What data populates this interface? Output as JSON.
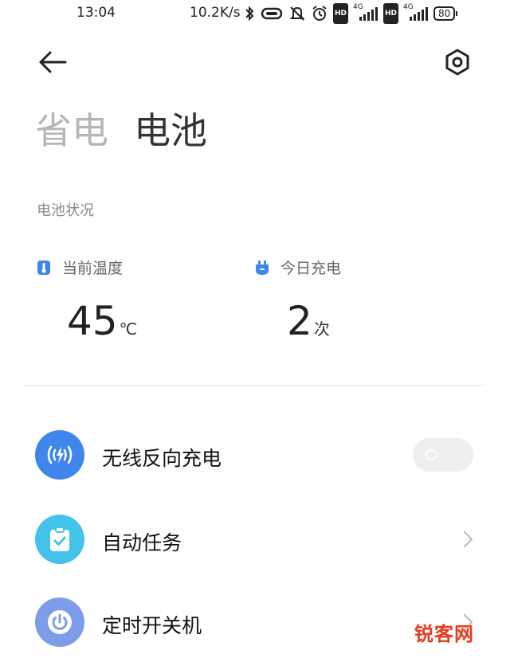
{
  "status_bar": {
    "time": "13:04",
    "net_speed": "10.2K/s",
    "signal_1_label": "4G",
    "signal_2_label": "4G",
    "hd_label": "HD",
    "battery_level": "80"
  },
  "header": {
    "tab_power_save": "省电",
    "tab_battery": "电池"
  },
  "battery_status": {
    "section_label": "电池状况",
    "temperature": {
      "label": "当前温度",
      "value": "45",
      "unit": "℃"
    },
    "charges_today": {
      "label": "今日充电",
      "value": "2",
      "unit": "次"
    }
  },
  "settings": {
    "wireless_reverse_charging": {
      "label": "无线反向充电",
      "enabled": false
    },
    "auto_tasks": {
      "label": "自动任务"
    },
    "scheduled_power": {
      "label": "定时开关机"
    }
  },
  "watermark": "锐客网",
  "colors": {
    "accent_blue": "#3e86ec",
    "accent_cyan": "#44c3ea",
    "accent_periwinkle": "#7d9de8"
  }
}
